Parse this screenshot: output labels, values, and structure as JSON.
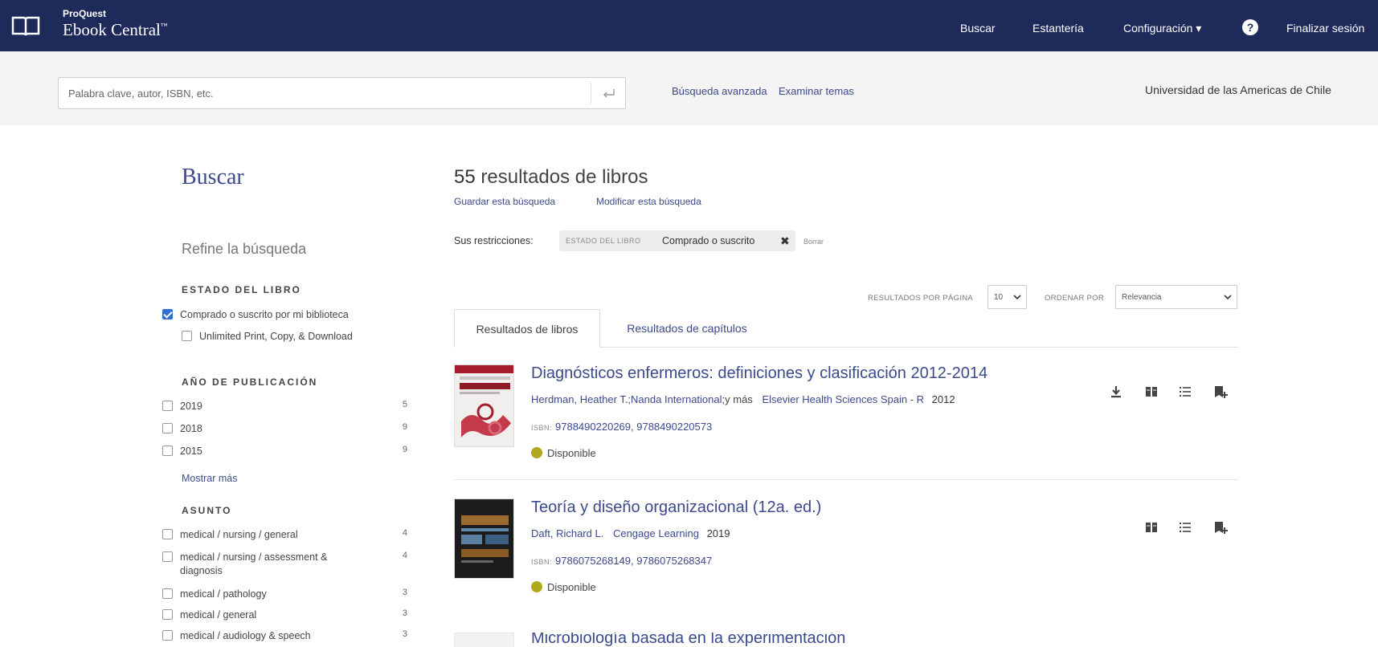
{
  "header": {
    "brand_small": "ProQuest",
    "brand_main": "Ebook Central",
    "brand_tm": "™",
    "nav": {
      "search": "Buscar",
      "bookshelf": "Estantería",
      "settings": "Configuración",
      "settings_caret": "▾",
      "help": "?",
      "logout": "Finalizar sesión"
    },
    "bg_color": "#1e2a5a"
  },
  "search": {
    "placeholder": "Palabra clave, autor, ISBN, etc.",
    "advanced_link": "Búsqueda avanzada",
    "browse_link": "Examinar temas",
    "institution": "Universidad de las Americas de Chile"
  },
  "sidebar": {
    "title": "Buscar",
    "refine_title": "Refine la búsqueda",
    "book_status": {
      "heading": "ESTADO DEL LIBRO",
      "items": [
        {
          "label": "Comprado o suscrito por mi biblioteca",
          "checked": true
        },
        {
          "label": "Unlimited Print, Copy, & Download",
          "checked": false
        }
      ]
    },
    "pub_year": {
      "heading": "AÑO DE PUBLICACIÓN",
      "items": [
        {
          "label": "2019",
          "count": "5"
        },
        {
          "label": "2018",
          "count": "9"
        },
        {
          "label": "2015",
          "count": "9"
        }
      ],
      "show_more": "Mostrar más"
    },
    "subject": {
      "heading": "ASUNTO",
      "items": [
        {
          "label": "medical / nursing / general",
          "count": "4"
        },
        {
          "label": "medical / nursing / assessment & diagnosis",
          "count": "4"
        },
        {
          "label": "medical / pathology",
          "count": "3"
        },
        {
          "label": "medical / general",
          "count": "3"
        },
        {
          "label": "medical / audiology & speech",
          "count": "3"
        }
      ]
    }
  },
  "results": {
    "count": "55",
    "count_label": "resultados de libros",
    "save_search": "Guardar esta búsqueda",
    "modify_search": "Modificar esta búsqueda",
    "restrictions_label": "Sus restricciones:",
    "restriction_key": "ESTADO DEL LIBRO",
    "restriction_value": "Comprado o suscrito",
    "restriction_remove": "✖",
    "clear": "Borrar",
    "per_page_label": "RESULTADOS POR PÁGINA",
    "per_page_value": "10",
    "sort_label": "ORDENAR POR",
    "sort_value": "Relevancia",
    "tabs": {
      "books": "Resultados de libros",
      "chapters": "Resultados de capítulos"
    },
    "isbn_label": "ISBN:",
    "available_label": "Disponible",
    "items": [
      {
        "title": "Diagnósticos enfermeros: definiciones y clasificación 2012-2014",
        "authors": "Herdman, Heather T.;Nanda International",
        "more": ";y más",
        "publisher": "Elsevier Health Sciences Spain - R",
        "year": "2012",
        "isbn": "9788490220269, 9788490220573",
        "status": "Disponible"
      },
      {
        "title": "Teoría y diseño organizacional (12a. ed.)",
        "authors": "Daft, Richard L.",
        "more": "",
        "publisher": "Cengage Learning",
        "year": "2019",
        "isbn": "9786075268149, 9786075268347",
        "status": "Disponible"
      },
      {
        "title": "Microbiología basada en la experimentación"
      }
    ]
  }
}
